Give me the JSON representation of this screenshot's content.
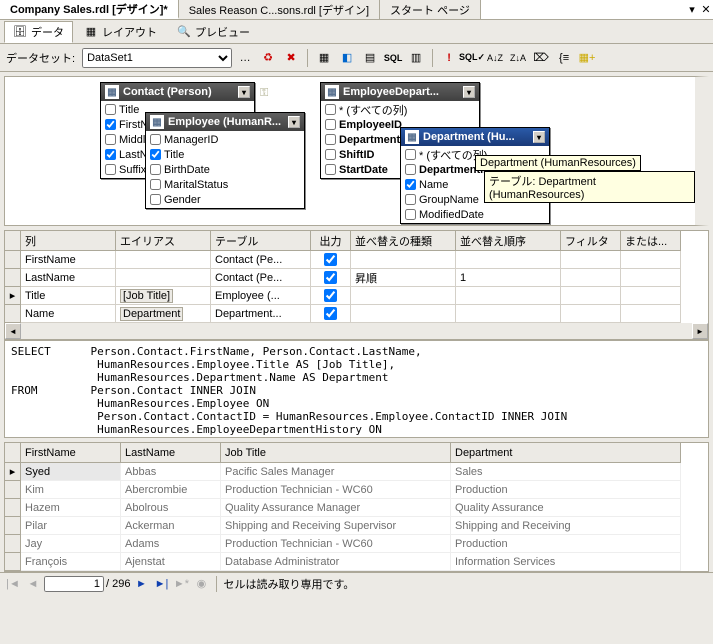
{
  "doc_tabs": [
    "Company Sales.rdl [デザイン]*",
    "Sales Reason C...sons.rdl [デザイン]",
    "スタート ページ"
  ],
  "subtabs": {
    "data": "データ",
    "layout": "レイアウト",
    "preview": "プレビュー"
  },
  "toolbar": {
    "dataset_label": "データセット:",
    "dataset_value": "DataSet1"
  },
  "tables": {
    "contact": {
      "title": "Contact (Person)",
      "cols": [
        {
          "n": "Title",
          "ck": false
        },
        {
          "n": "FirstName",
          "ck": true
        },
        {
          "n": "MiddleName",
          "ck": false
        },
        {
          "n": "LastName",
          "ck": true
        },
        {
          "n": "Suffix",
          "ck": false
        }
      ]
    },
    "employee": {
      "title": "Employee (HumanR...",
      "cols": [
        {
          "n": "ManagerID",
          "ck": false
        },
        {
          "n": "Title",
          "ck": true
        },
        {
          "n": "BirthDate",
          "ck": false
        },
        {
          "n": "MaritalStatus",
          "ck": false
        },
        {
          "n": "Gender",
          "ck": false
        }
      ]
    },
    "empdept": {
      "title": "EmployeeDepart...",
      "cols": [
        {
          "n": "* (すべての列)",
          "ck": false,
          "b": false
        },
        {
          "n": "EmployeeID",
          "ck": false,
          "b": true
        },
        {
          "n": "DepartmentID",
          "ck": false,
          "b": true
        },
        {
          "n": "ShiftID",
          "ck": false,
          "b": true
        },
        {
          "n": "StartDate",
          "ck": false,
          "b": true
        }
      ]
    },
    "dept": {
      "title": "Department (Hu...",
      "cols": [
        {
          "n": "* (すべての列)",
          "ck": false
        },
        {
          "n": "DepartmentID",
          "ck": false,
          "b": true
        },
        {
          "n": "Name",
          "ck": true
        },
        {
          "n": "GroupName",
          "ck": false
        },
        {
          "n": "ModifiedDate",
          "ck": false
        }
      ]
    }
  },
  "tooltip1": "Department (HumanResources)",
  "tooltip2": "テーブル: Department (HumanResources)",
  "grid": {
    "headers": [
      "列",
      "エイリアス",
      "テーブル",
      "出力",
      "並べ替えの種類",
      "並べ替え順序",
      "フィルタ",
      "または..."
    ],
    "rows": [
      {
        "col": "FirstName",
        "alias": "",
        "table": "Contact (Pe...",
        "out": true,
        "sortType": "",
        "sortOrd": "",
        "filter": "",
        "or": ""
      },
      {
        "col": "LastName",
        "alias": "",
        "table": "Contact (Pe...",
        "out": true,
        "sortType": "昇順",
        "sortOrd": "1",
        "filter": "",
        "or": ""
      },
      {
        "col": "Title",
        "alias": "[Job Title]",
        "table": "Employee (...",
        "out": true,
        "sortType": "",
        "sortOrd": "",
        "filter": "",
        "or": "",
        "sel": true
      },
      {
        "col": "Name",
        "alias": "Department",
        "table": "Department...",
        "out": true,
        "sortType": "",
        "sortOrd": "",
        "filter": "",
        "or": ""
      }
    ]
  },
  "sql": "SELECT      Person.Contact.FirstName, Person.Contact.LastName,\n             HumanResources.Employee.Title AS [Job Title],\n             HumanResources.Department.Name AS Department\nFROM        Person.Contact INNER JOIN\n             HumanResources.Employee ON\n             Person.Contact.ContactID = HumanResources.Employee.ContactID INNER JOIN\n             HumanResources.EmployeeDepartmentHistory ON\n             HumanResources.Employee.EmployeeID = HumanResources.EmployeeDepartmentHistory.EmployeeID",
  "results": {
    "headers": [
      "FirstName",
      "LastName",
      "Job Title",
      "Department"
    ],
    "rows": [
      [
        "Syed",
        "Abbas",
        "Pacific Sales Manager",
        "Sales"
      ],
      [
        "Kim",
        "Abercrombie",
        "Production Technician - WC60",
        "Production"
      ],
      [
        "Hazem",
        "Abolrous",
        "Quality Assurance Manager",
        "Quality Assurance"
      ],
      [
        "Pilar",
        "Ackerman",
        "Shipping and Receiving Supervisor",
        "Shipping and Receiving"
      ],
      [
        "Jay",
        "Adams",
        "Production Technician - WC60",
        "Production"
      ],
      [
        "François",
        "Ajenstat",
        "Database Administrator",
        "Information Services"
      ]
    ]
  },
  "nav": {
    "page": "1",
    "total": "/ 296",
    "status": "セルは読み取り専用です。"
  }
}
